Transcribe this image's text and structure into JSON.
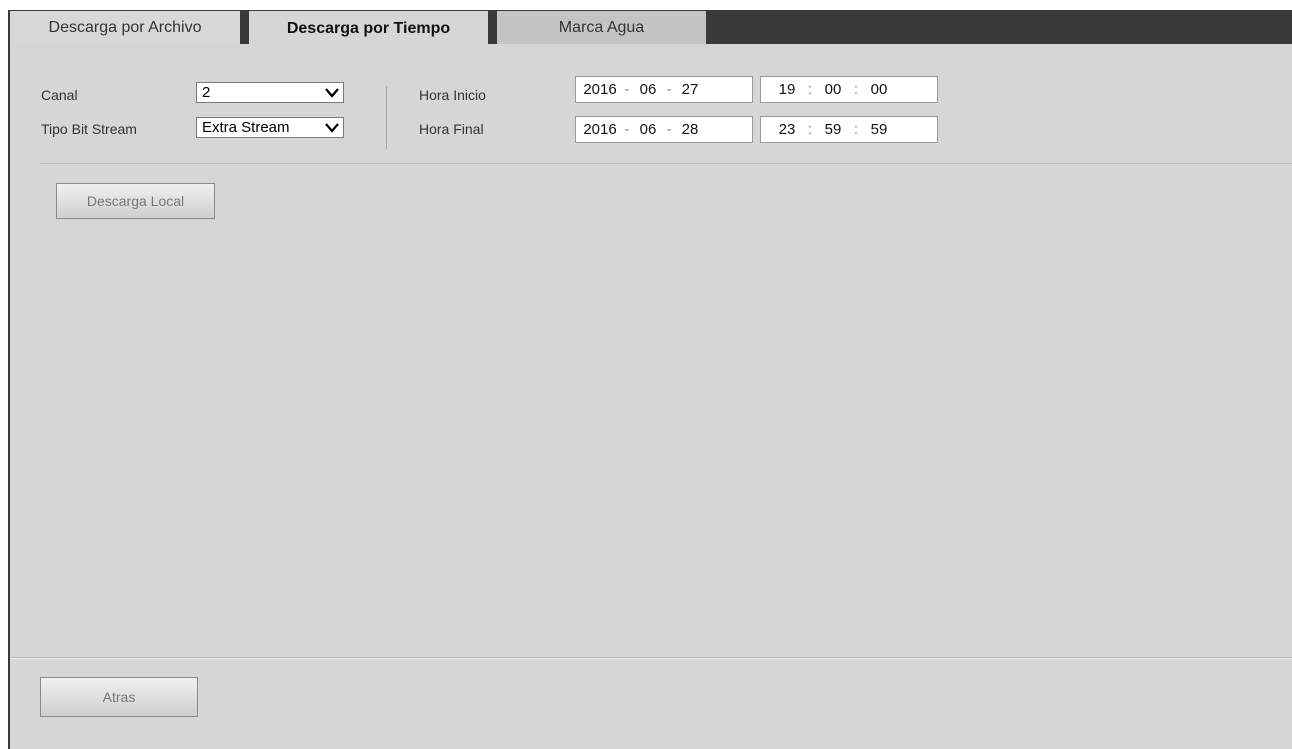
{
  "tabs": [
    {
      "label": "Descarga por Archivo"
    },
    {
      "label": "Descarga por Tiempo"
    },
    {
      "label": "Marca Agua"
    }
  ],
  "form": {
    "canal_label": "Canal",
    "canal_value": "2",
    "stream_label": "Tipo Bit Stream",
    "stream_value": "Extra Stream",
    "start_label": "Hora Inicio",
    "end_label": "Hora Final",
    "start": {
      "year": "2016",
      "month": "06",
      "day": "27",
      "hour": "19",
      "minute": "00",
      "second": "00"
    },
    "end": {
      "year": "2016",
      "month": "06",
      "day": "28",
      "hour": "23",
      "minute": "59",
      "second": "59"
    },
    "date_sep": "-",
    "time_sep": ":"
  },
  "buttons": {
    "local_download": "Descarga Local",
    "back": "Atras"
  },
  "icons": {
    "dropdown": "chevron-down-icon"
  }
}
